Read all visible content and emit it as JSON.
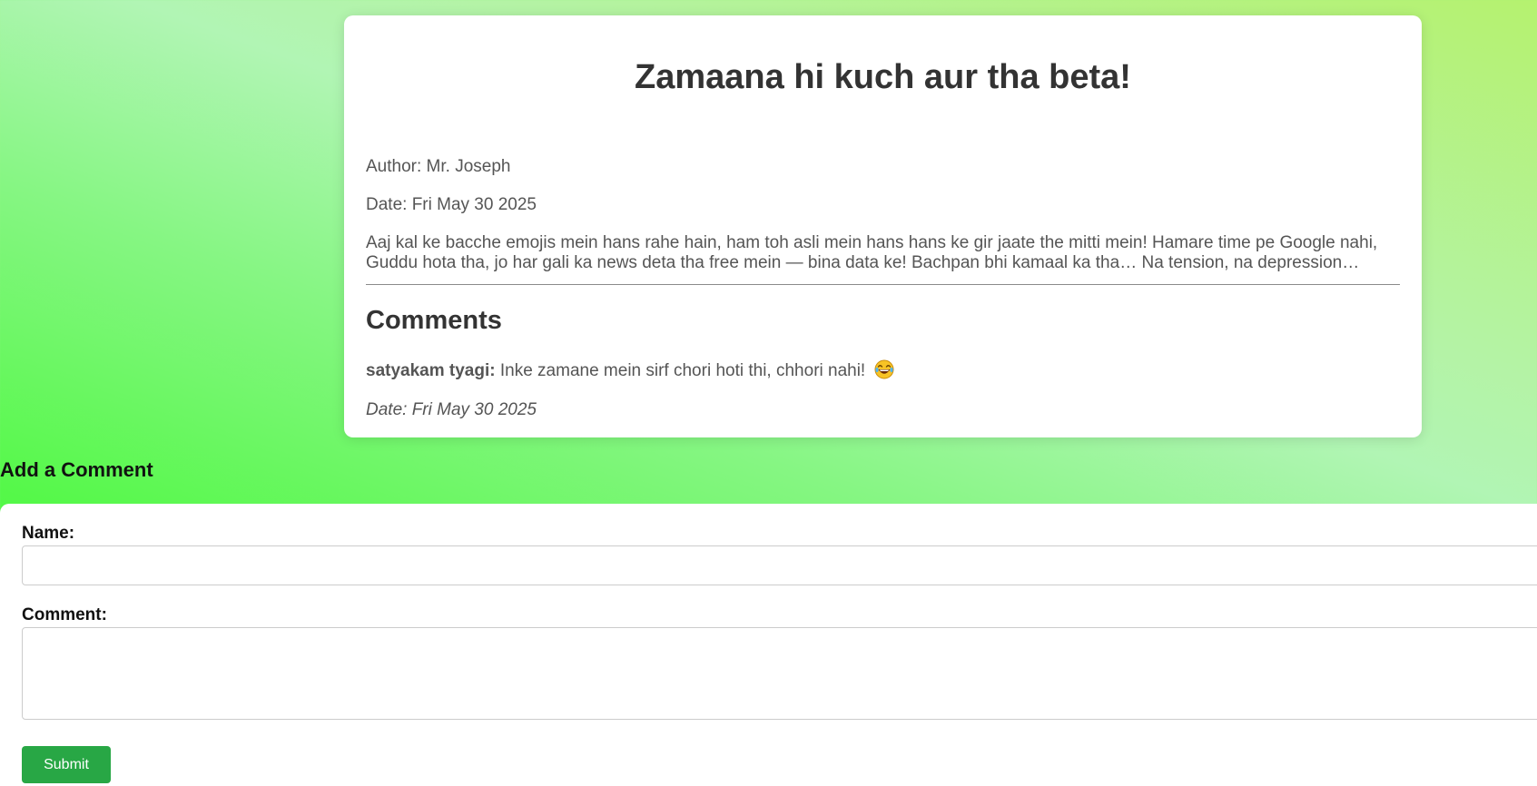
{
  "post": {
    "title": "Zamaana hi kuch aur tha beta!",
    "author": "Author: Mr. Joseph",
    "date": "Date: Fri May 30 2025",
    "body": "Aaj kal ke bacche emojis mein hans rahe hain, ham toh asli mein hans hans ke gir jaate the mitti mein! Hamare time pe Google nahi, Guddu hota tha, jo har gali ka news deta tha free mein — bina data ke! Bachpan bhi kamaal ka tha… Na tension, na depression…"
  },
  "comments": {
    "heading": "Comments",
    "items": [
      {
        "author": "satyakam tyagi:",
        "text": " Inke zamane mein sirf chori hoti thi, chhori nahi! ",
        "emoji_icon": "laughing-tears-emoji-icon",
        "date": "Date: Fri May 30 2025"
      }
    ]
  },
  "form": {
    "heading": "Add a Comment",
    "name_label": "Name:",
    "name_value": "",
    "comment_label": "Comment:",
    "comment_value": "",
    "submit_label": "Submit"
  },
  "colors": {
    "submit_button": "#28a745",
    "card_background": "#ffffff",
    "title_text": "#333333",
    "body_text": "#555555"
  }
}
